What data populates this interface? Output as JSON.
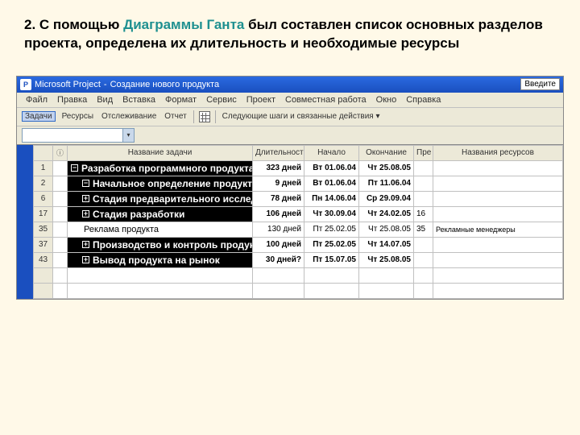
{
  "slide": {
    "text_before": "2. С помощью ",
    "highlight": "Диаграммы Ганта",
    "text_after": " был составлен список основных разделов проекта, определена их длительность и необходимые ресурсы"
  },
  "titlebar": {
    "app": "Microsoft Project",
    "doc": "Создание нового продукта",
    "help": "Введите"
  },
  "menu": [
    "Файл",
    "Правка",
    "Вид",
    "Вставка",
    "Формат",
    "Сервис",
    "Проект",
    "Совместная работа",
    "Окно",
    "Справка"
  ],
  "toolbar": {
    "tasks": "Задачи",
    "resources": "Ресурсы",
    "tracking": "Отслеживание",
    "report": "Отчет",
    "next": "Следующие шаги и связанные действия ▾"
  },
  "columns": {
    "info": "",
    "name": "Название задачи",
    "duration": "Длительность",
    "start": "Начало",
    "finish": "Окончание",
    "pred": "Пре",
    "res": "Названия ресурсов"
  },
  "rows": [
    {
      "num": "1",
      "bold": true,
      "level": 1,
      "icon": "−",
      "name": "Разработка программного продукта",
      "dur": "323 дней",
      "start": "Вт 01.06.04",
      "end": "Чт 25.08.05",
      "pred": "",
      "res": ""
    },
    {
      "num": "2",
      "bold": true,
      "level": 2,
      "icon": "−",
      "name": "Начальное определение продукта",
      "dur": "9 дней",
      "start": "Вт 01.06.04",
      "end": "Пт 11.06.04",
      "pred": "",
      "res": ""
    },
    {
      "num": "6",
      "bold": true,
      "level": 2,
      "icon": "+",
      "name": "Стадия предварительного исследования",
      "dur": "78 дней",
      "start": "Пн 14.06.04",
      "end": "Ср 29.09.04",
      "pred": "",
      "res": ""
    },
    {
      "num": "17",
      "bold": true,
      "level": 2,
      "icon": "+",
      "name": "Стадия разработки",
      "dur": "106 дней",
      "start": "Чт 30.09.04",
      "end": "Чт 24.02.05",
      "pred": "16",
      "res": ""
    },
    {
      "num": "35",
      "bold": false,
      "level": 2,
      "icon": "",
      "name": "Реклама продукта",
      "dur": "130 дней",
      "start": "Пт 25.02.05",
      "end": "Чт 25.08.05",
      "pred": "35",
      "res": "Рекламные менеджеры"
    },
    {
      "num": "37",
      "bold": true,
      "level": 2,
      "icon": "+",
      "name": "Производство и контроль продукта",
      "dur": "100 дней",
      "start": "Пт 25.02.05",
      "end": "Чт 14.07.05",
      "pred": "",
      "res": ""
    },
    {
      "num": "43",
      "bold": true,
      "level": 2,
      "icon": "+",
      "name": "Вывод продукта на рынок",
      "dur": "30 дней?",
      "start": "Пт 15.07.05",
      "end": "Чт 25.08.05",
      "pred": "",
      "res": ""
    }
  ]
}
